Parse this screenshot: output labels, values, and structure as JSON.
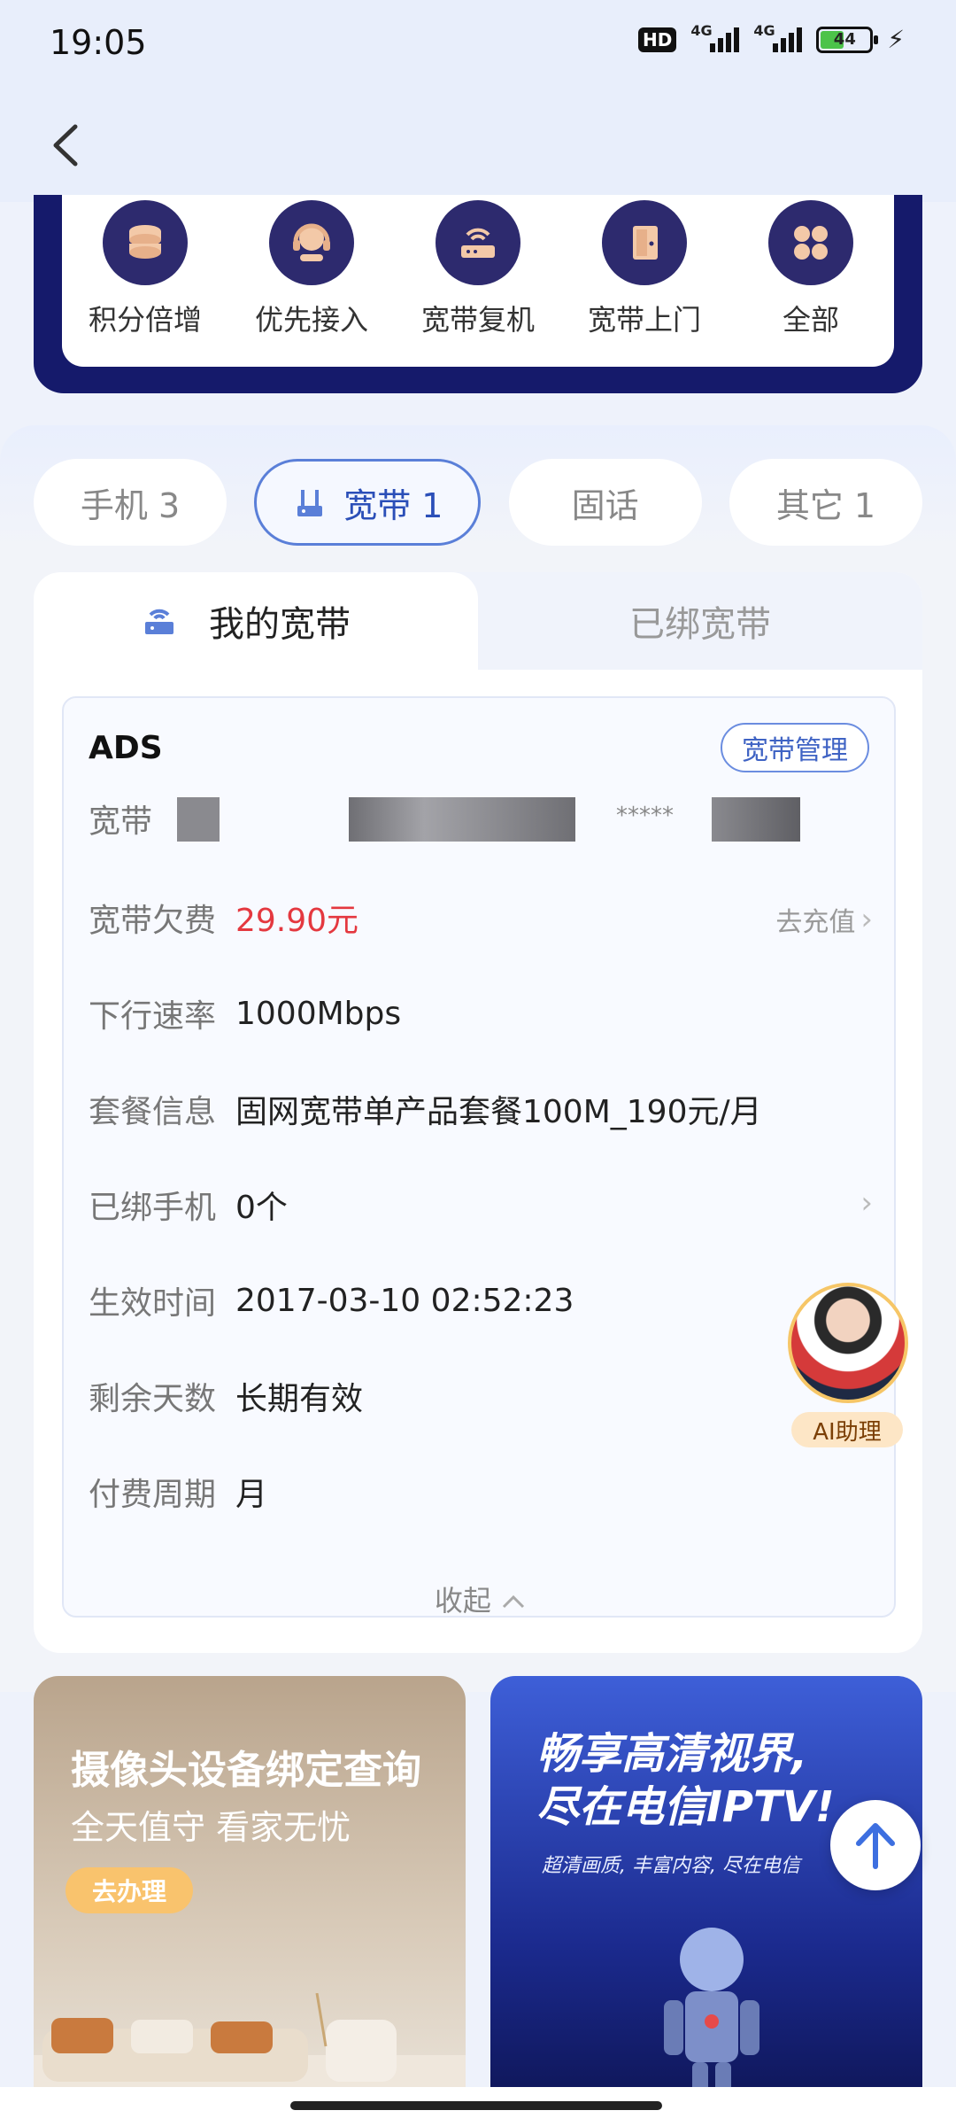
{
  "status_bar": {
    "time": "19:05",
    "hd_badge": "HD",
    "signal1_label": "4G",
    "signal2_label": "4G",
    "battery_level": "44",
    "icons": [
      "hd-icon",
      "signal-icon",
      "signal-icon",
      "battery-icon",
      "charging-icon"
    ]
  },
  "nav": {
    "back_icon": "chevron-left-icon"
  },
  "services": [
    {
      "label": "积分倍增",
      "icon": "coins-icon"
    },
    {
      "label": "优先接入",
      "icon": "headset-icon"
    },
    {
      "label": "宽带复机",
      "icon": "router-icon"
    },
    {
      "label": "宽带上门",
      "icon": "door-icon"
    },
    {
      "label": "全部",
      "icon": "grid-icon"
    }
  ],
  "tabs": [
    {
      "label": "手机 3",
      "active": false
    },
    {
      "label": "宽带 1",
      "active": true,
      "icon": "router-icon"
    },
    {
      "label": "固话",
      "active": false
    },
    {
      "label": "其它 1",
      "active": false
    }
  ],
  "subtabs": {
    "mine": "我的宽带",
    "bound": "已绑宽带"
  },
  "broadband": {
    "account_prefix": "ADS",
    "manage_button": "宽带管理",
    "number_label": "宽带",
    "number_masked": "*****",
    "fields": [
      {
        "key": "宽带欠费",
        "value": "29.90元",
        "highlight": true,
        "action": "去充值"
      },
      {
        "key": "下行速率",
        "value": "1000Mbps"
      },
      {
        "key": "套餐信息",
        "value": "固网宽带单产品套餐100M_190元/月"
      },
      {
        "key": "已绑手机",
        "value": "0个",
        "chevron": true
      },
      {
        "key": "生效时间",
        "value": "2017-03-10 02:52:23"
      },
      {
        "key": "剩余天数",
        "value": "长期有效"
      },
      {
        "key": "付费周期",
        "value": "月"
      }
    ],
    "collapse_label": "收起"
  },
  "ai_helper": {
    "label": "AI助理"
  },
  "promos": {
    "left": {
      "title": "摄像头设备绑定查询",
      "subtitle": "全天值守  看家无忧",
      "button": "去办理"
    },
    "right": {
      "title_line1": "畅享高清视界,",
      "title_line2": "尽在电信IPTV!",
      "subtitle": "超清画质, 丰富内容, 尽在电信"
    }
  },
  "colors": {
    "accent": "#2b4fb8",
    "navy": "#151a6b",
    "red": "#e4383f",
    "gold": "#f9c36d"
  }
}
